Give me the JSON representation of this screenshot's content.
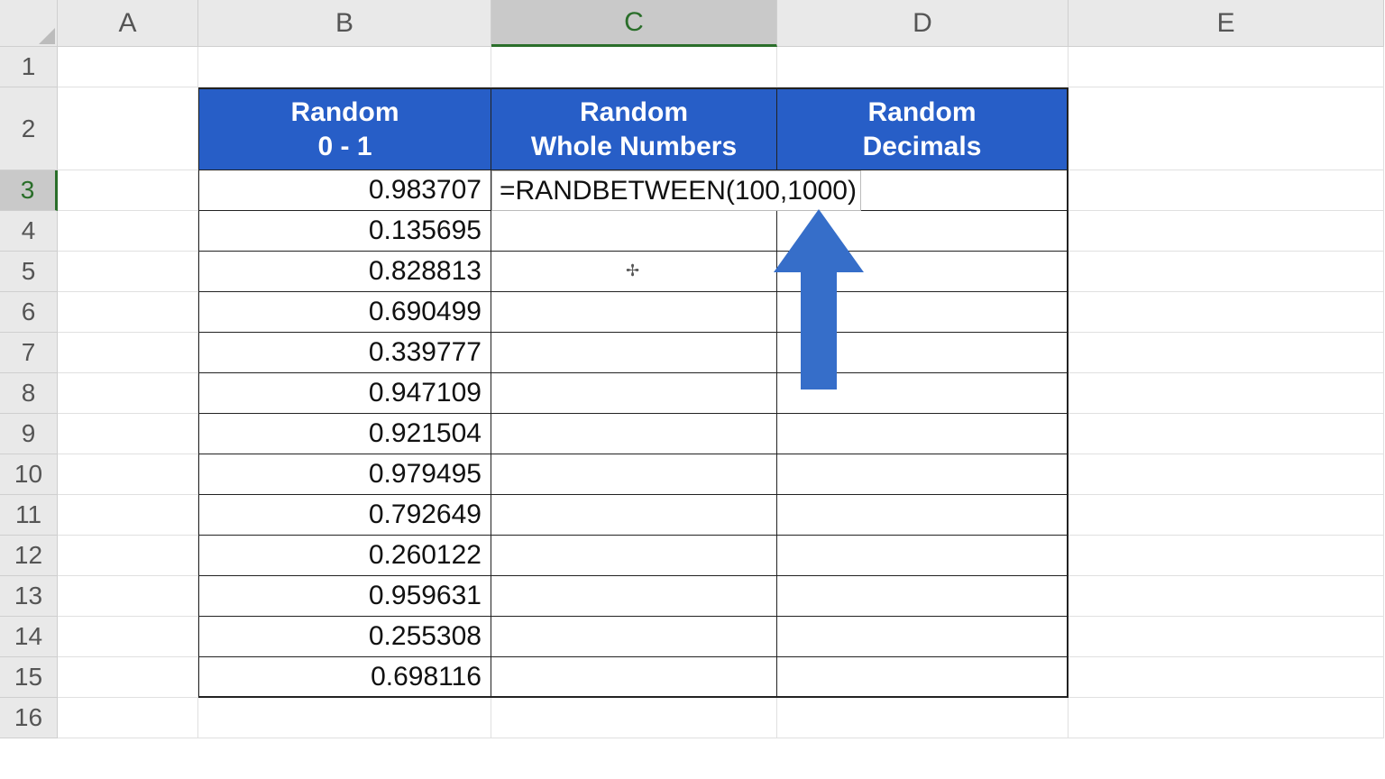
{
  "columns": [
    "A",
    "B",
    "C",
    "D",
    "E"
  ],
  "rows": [
    "1",
    "2",
    "3",
    "4",
    "5",
    "6",
    "7",
    "8",
    "9",
    "10",
    "11",
    "12",
    "13",
    "14",
    "15",
    "16"
  ],
  "selected_column": "C",
  "selected_row": "3",
  "headers": {
    "B": {
      "line1": "Random",
      "line2": "0 - 1"
    },
    "C": {
      "line1": "Random",
      "line2": "Whole Numbers"
    },
    "D": {
      "line1": "Random",
      "line2": "Decimals"
    }
  },
  "formula_cell": "=RANDBETWEEN(100,1000)",
  "col_b_values": [
    "0.983707",
    "0.135695",
    "0.828813",
    "0.690499",
    "0.339777",
    "0.947109",
    "0.921504",
    "0.979495",
    "0.792649",
    "0.260122",
    "0.959631",
    "0.255308",
    "0.698116"
  ],
  "cursor_glyph": "✢",
  "arrow_color": "#366ec9"
}
